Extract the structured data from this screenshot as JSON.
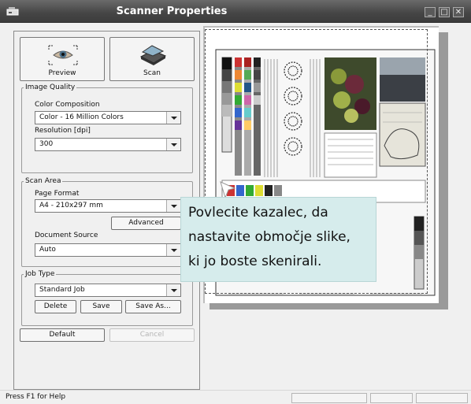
{
  "window": {
    "title": "Scanner Properties",
    "icons": [
      "scanner-app-icon",
      "minimize-icon",
      "maximize-icon",
      "close-icon"
    ]
  },
  "toolbar": {
    "preview_label": "Preview",
    "scan_label": "Scan"
  },
  "image_quality": {
    "legend": "Image Quality",
    "color_label": "Color Composition",
    "color_value": "Color - 16 Million Colors",
    "resolution_label": "Resolution [dpi]",
    "resolution_value": "300"
  },
  "scan_area": {
    "legend": "Scan Area",
    "page_format_label": "Page Format",
    "page_format_value": "A4 - 210x297 mm",
    "advanced_label": "Advanced",
    "doc_source_label": "Document Source",
    "doc_source_value": "Auto"
  },
  "job_type": {
    "legend": "Job Type",
    "value": "Standard Job",
    "delete_label": "Delete",
    "save_label": "Save",
    "save_as_label": "Save As..."
  },
  "footer": {
    "default_label": "Default",
    "cancel_label": "Cancel"
  },
  "tooltip": {
    "line1": "Povlecite kazalec, da",
    "line2": "nastavite območje slike,",
    "line3": "ki jo boste skenirali."
  },
  "status": {
    "help": "Press F1 for Help"
  },
  "colors": {
    "titlebar": "#454545",
    "panel": "#f0f0f0",
    "tooltip": "#d6ecec"
  }
}
